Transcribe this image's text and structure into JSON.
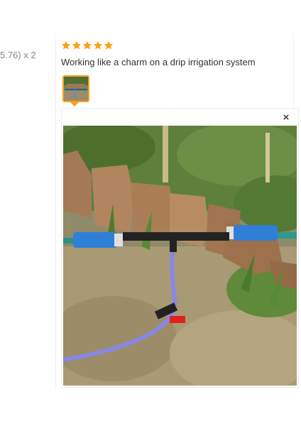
{
  "left_fragment": "5.76) x 2",
  "review": {
    "rating": 5,
    "rating_max": 5,
    "text": "Working like a charm on a drip irrigation system",
    "thumbnail_count": 1
  },
  "viewer": {
    "close_icon": "close-icon",
    "close_glyph": "×"
  },
  "colors": {
    "star": "#ff9f1a",
    "thumb_border": "#ff9f1a"
  }
}
